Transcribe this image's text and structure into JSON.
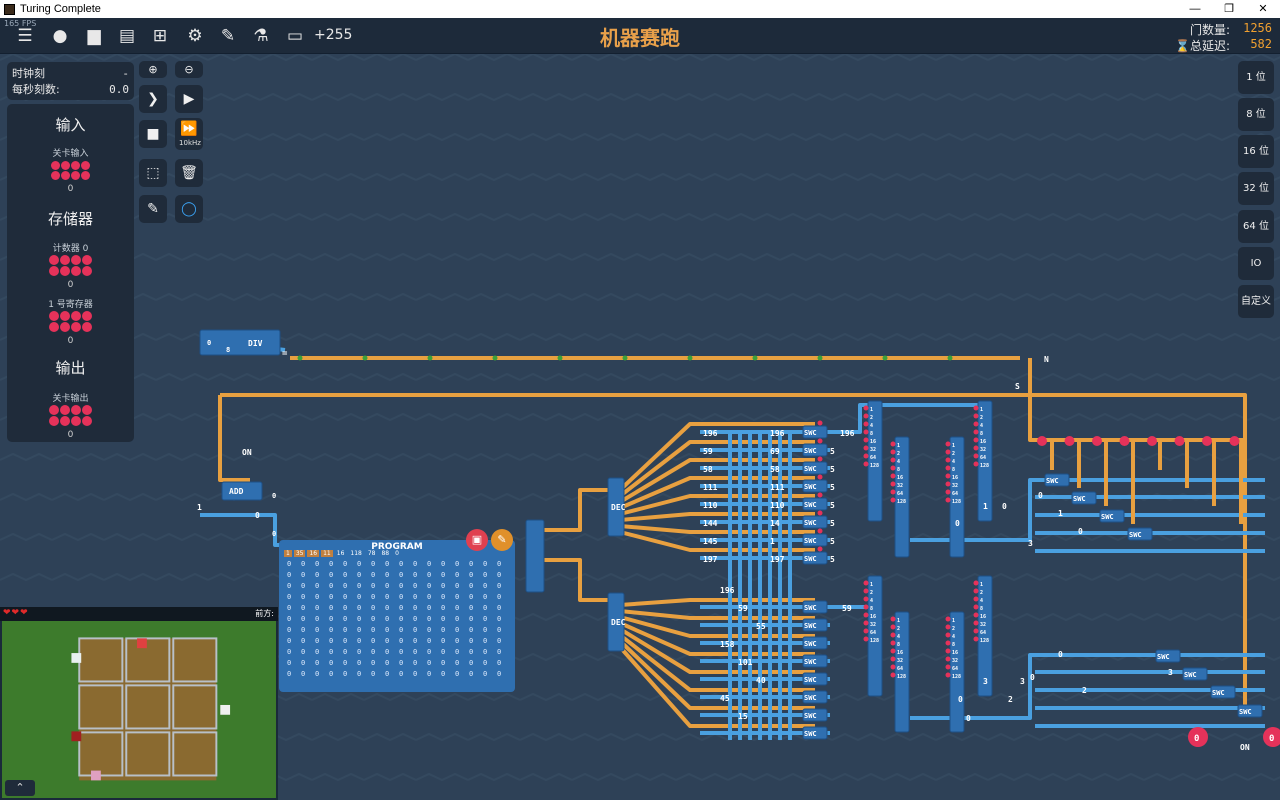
{
  "window": {
    "title": "Turing Complete",
    "minimize": "—",
    "restore": "❐",
    "close": "✕"
  },
  "topbar": {
    "fps": "165 FPS",
    "delta": "+255",
    "level_title": "机器赛跑",
    "gate_count_label": "门数量:",
    "gate_count": "1256",
    "delay_label": "⌛总延迟:",
    "delay": "582"
  },
  "clock": {
    "tick_label": "时钟刻",
    "tick_value": "-",
    "tps_label": "每秒刻数:",
    "tps_value": "0.0"
  },
  "io": {
    "input_title": "输入",
    "level_input_label": "关卡输入",
    "level_input_value": "0",
    "storage_title": "存储器",
    "counter_label": "计数器 0",
    "counter_value": "0",
    "register_label": "1 号寄存器",
    "register_value": "0",
    "output_title": "输出",
    "level_output_label": "关卡输出",
    "level_output_value": "0"
  },
  "tools": {
    "speed_label": "10kHz"
  },
  "bits": [
    "1 位",
    "8 位",
    "16 位",
    "32 位",
    "64 位",
    "IO",
    "自定义"
  ],
  "preview": {
    "hearts": "❤❤❤",
    "direction": "前方:"
  },
  "program": {
    "title": "PROGRAM",
    "header": [
      "1",
      "35",
      "16",
      "11",
      "16",
      "118",
      "78",
      "88",
      "0"
    ],
    "cell": "0"
  },
  "components": {
    "div": "DIV",
    "add": "ADD",
    "on1": "ON",
    "on2": "ON",
    "dec1": "DEC",
    "dec2": "DEC",
    "swc": "SWC",
    "n_label": "N",
    "s_label": "S",
    "eq": "="
  },
  "values": {
    "top_a": "0",
    "top_b": "8",
    "add_in": "1",
    "add_out": "0",
    "add_zero": "0",
    "r1": [
      "196",
      "59",
      "58",
      "111",
      "110",
      "144",
      "145",
      "197"
    ],
    "r1_right": [
      "196",
      "69",
      "58",
      "111",
      "110",
      "14",
      "1",
      "197"
    ],
    "r2": [
      "196",
      "59",
      "55",
      "158",
      "101",
      "40",
      "45",
      "15"
    ],
    "c196": "196",
    "c59": "59",
    "five": "5",
    "mux1": [
      "0",
      "1",
      "0",
      "3"
    ],
    "mux2": [
      "0",
      "3",
      "2",
      "3",
      "0"
    ],
    "bot_zero": "0",
    "end_zero": "0"
  },
  "colors": {
    "bg": "#2e4157",
    "wire_orange": "#e8a040",
    "wire_blue": "#4aa0e0",
    "pin_red": "#e5325a",
    "accent": "#e8a04a"
  }
}
